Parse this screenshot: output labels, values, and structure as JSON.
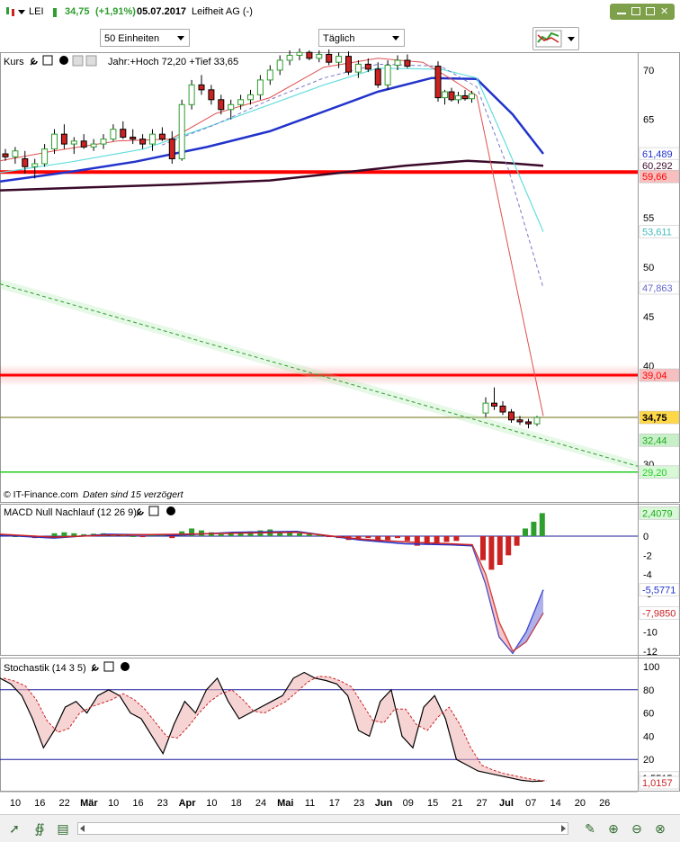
{
  "header": {
    "symbol": "LEI",
    "price": "34,75",
    "change": "(+1,91%)",
    "date": "05.07.2017",
    "name": "Leifheit AG (-)"
  },
  "controls": {
    "units": "50 Einheiten",
    "interval": "Täglich"
  },
  "panels": {
    "price": {
      "label": "Kurs",
      "info": "Jahr:+Hoch 72,20 +Tief 33,65",
      "source": "© IT-Finance.com",
      "delay": "Daten sind 15 verzögert"
    },
    "macd": {
      "label": "MACD Null Nachlauf (12 26 9)"
    },
    "stoch": {
      "label": "Stochastik (14 3 5)"
    }
  },
  "colors": {
    "up": "#2e9e2e",
    "down": "#cc2222",
    "sma_blue": "#2233cc",
    "sma_dark": "#3a0a2a",
    "cyan": "#66dddd",
    "dashed": "#7777cc",
    "red_line": "#ff0000",
    "support": "#22cc22"
  },
  "chart_data": [
    {
      "type": "candlestick",
      "title": "Kurs",
      "y_ticks": [
        70,
        65,
        55,
        50,
        45,
        40,
        30
      ],
      "ylim": [
        29,
        71
      ],
      "x_labels": [
        "10",
        "16",
        "22",
        "Mär",
        "10",
        "16",
        "23",
        "Apr",
        "10",
        "18",
        "24",
        "Mai",
        "11",
        "17",
        "23",
        "Jun",
        "09",
        "15",
        "21",
        "27",
        "Jul",
        "07",
        "14",
        "20",
        "26"
      ],
      "price_labels": [
        {
          "value": "61,489",
          "color": "#2233cc"
        },
        {
          "value": "60,292",
          "color": "#3a0a2a"
        },
        {
          "value": "59,66",
          "color": "#ff0000"
        },
        {
          "value": "53,611",
          "color": "#44bbbb"
        },
        {
          "value": "47,863",
          "color": "#6666cc"
        },
        {
          "value": "39,04",
          "color": "#ff0000"
        },
        {
          "value": "34,75",
          "color": "#000000"
        },
        {
          "value": "32,44",
          "color": "#22aa22"
        },
        {
          "value": "29,20",
          "color": "#22cc22"
        }
      ],
      "horizontal_lines": [
        59.66,
        39.04,
        29.2,
        34.75
      ],
      "candles": [
        [
          61.5,
          62.0,
          60.8,
          61.2
        ],
        [
          61.2,
          62.2,
          60.5,
          61.8
        ],
        [
          61.0,
          61.8,
          59.5,
          60.2
        ],
        [
          60.2,
          61.0,
          59.0,
          60.5
        ],
        [
          60.5,
          62.5,
          60.2,
          62.0
        ],
        [
          62.0,
          64.0,
          61.5,
          63.5
        ],
        [
          63.5,
          64.5,
          62.0,
          62.5
        ],
        [
          62.5,
          63.2,
          61.5,
          62.8
        ],
        [
          62.8,
          63.5,
          62.0,
          62.2
        ],
        [
          62.2,
          63.0,
          61.8,
          62.5
        ],
        [
          62.5,
          63.5,
          62.0,
          63.0
        ],
        [
          63.0,
          64.5,
          62.8,
          64.0
        ],
        [
          64.0,
          64.8,
          63.0,
          63.2
        ],
        [
          63.2,
          64.0,
          62.5,
          63.0
        ],
        [
          63.0,
          63.5,
          62.0,
          62.5
        ],
        [
          62.5,
          64.0,
          61.8,
          63.5
        ],
        [
          63.5,
          64.2,
          62.8,
          63.0
        ],
        [
          63.0,
          63.8,
          60.5,
          61.0
        ],
        [
          61.0,
          67.0,
          60.8,
          66.5
        ],
        [
          66.5,
          69.0,
          66.0,
          68.5
        ],
        [
          68.5,
          69.5,
          67.5,
          68.0
        ],
        [
          68.0,
          68.5,
          66.5,
          67.0
        ],
        [
          67.0,
          67.5,
          65.5,
          66.0
        ],
        [
          66.0,
          67.0,
          65.0,
          66.5
        ],
        [
          66.5,
          67.5,
          66.0,
          67.0
        ],
        [
          67.0,
          68.0,
          66.5,
          67.5
        ],
        [
          67.5,
          69.5,
          67.0,
          69.0
        ],
        [
          69.0,
          70.5,
          68.5,
          70.0
        ],
        [
          70.0,
          71.5,
          69.5,
          71.0
        ],
        [
          71.0,
          72.0,
          70.5,
          71.5
        ],
        [
          71.5,
          72.2,
          71.0,
          71.8
        ],
        [
          71.8,
          72.0,
          71.0,
          71.2
        ],
        [
          71.2,
          72.0,
          70.8,
          71.6
        ],
        [
          71.6,
          72.1,
          70.5,
          70.8
        ],
        [
          70.8,
          71.8,
          70.2,
          71.4
        ],
        [
          71.4,
          71.9,
          69.5,
          69.8
        ],
        [
          69.8,
          71.0,
          69.2,
          70.6
        ],
        [
          70.6,
          71.2,
          69.8,
          70.1
        ],
        [
          70.1,
          70.8,
          68.2,
          68.5
        ],
        [
          68.5,
          71.0,
          68.0,
          70.5
        ],
        [
          70.5,
          71.5,
          70.0,
          71.0
        ],
        [
          71.0,
          71.6,
          70.2,
          70.4
        ],
        [
          70.4,
          70.9,
          66.8,
          67.2
        ],
        [
          67.2,
          68.0,
          66.5,
          67.8
        ],
        [
          67.8,
          68.2,
          66.8,
          67.0
        ],
        [
          67.0,
          67.8,
          66.6,
          67.4
        ],
        [
          67.4,
          68.0,
          66.9,
          67.1
        ],
        [
          67.1,
          67.9,
          66.7,
          67.6
        ],
        [
          35.2,
          36.8,
          34.8,
          36.2
        ],
        [
          36.2,
          37.8,
          35.5,
          35.9
        ],
        [
          35.9,
          36.4,
          35.0,
          35.3
        ],
        [
          35.3,
          35.6,
          34.2,
          34.5
        ],
        [
          34.5,
          34.9,
          34.0,
          34.3
        ],
        [
          34.3,
          34.6,
          33.65,
          34.1
        ],
        [
          34.1,
          34.9,
          33.9,
          34.75
        ]
      ]
    },
    {
      "type": "bar",
      "title": "MACD Null Nachlauf (12 26 9)",
      "y_ticks": [
        0,
        -2,
        -4,
        -6,
        -8,
        -10,
        -12
      ],
      "ylim": [
        -12.7,
        3.0
      ],
      "values": [
        0.1,
        0.0,
        0.05,
        -0.2,
        -0.1,
        0.3,
        0.4,
        0.3,
        0.2,
        0.25,
        0.3,
        0.2,
        0.1,
        0.0,
        -0.1,
        0.2,
        0.1,
        -0.2,
        0.5,
        0.8,
        0.6,
        0.4,
        0.2,
        0.3,
        0.4,
        0.5,
        0.6,
        0.7,
        0.5,
        0.4,
        0.3,
        0.2,
        0.1,
        -0.1,
        -0.2,
        -0.4,
        -0.3,
        -0.2,
        -0.5,
        -0.4,
        -0.2,
        -0.5,
        -1.0,
        -0.9,
        -0.8,
        -0.6,
        -0.5,
        -2.5,
        -3.5,
        -3.0,
        -2.0,
        -1.0,
        0.8,
        1.5,
        2.4
      ],
      "value_labels": [
        {
          "value": "2,4079",
          "color": "#22aa22"
        },
        {
          "value": "-5,5771",
          "color": "#2233cc"
        },
        {
          "value": "-7,9850",
          "color": "#cc2222"
        }
      ]
    },
    {
      "type": "line",
      "title": "Stochastik (14 3 5)",
      "y_ticks": [
        100,
        80,
        60,
        40,
        20
      ],
      "ylim": [
        0,
        100
      ],
      "series": [
        {
          "values": [
            90,
            85,
            75,
            55,
            30,
            45,
            65,
            70,
            60,
            75,
            80,
            75,
            60,
            55,
            40,
            25,
            50,
            70,
            60,
            80,
            90,
            70,
            55,
            60,
            65,
            70,
            75,
            90,
            95,
            90,
            88,
            85,
            75,
            45,
            40,
            70,
            80,
            40,
            30,
            65,
            75,
            55,
            20,
            15,
            10,
            8,
            6,
            4,
            2,
            1,
            1.5
          ]
        }
      ],
      "value_labels": [
        {
          "value": "1,5515",
          "color": "#000000"
        },
        {
          "value": "1,0157",
          "color": "#cc2222"
        }
      ]
    }
  ]
}
